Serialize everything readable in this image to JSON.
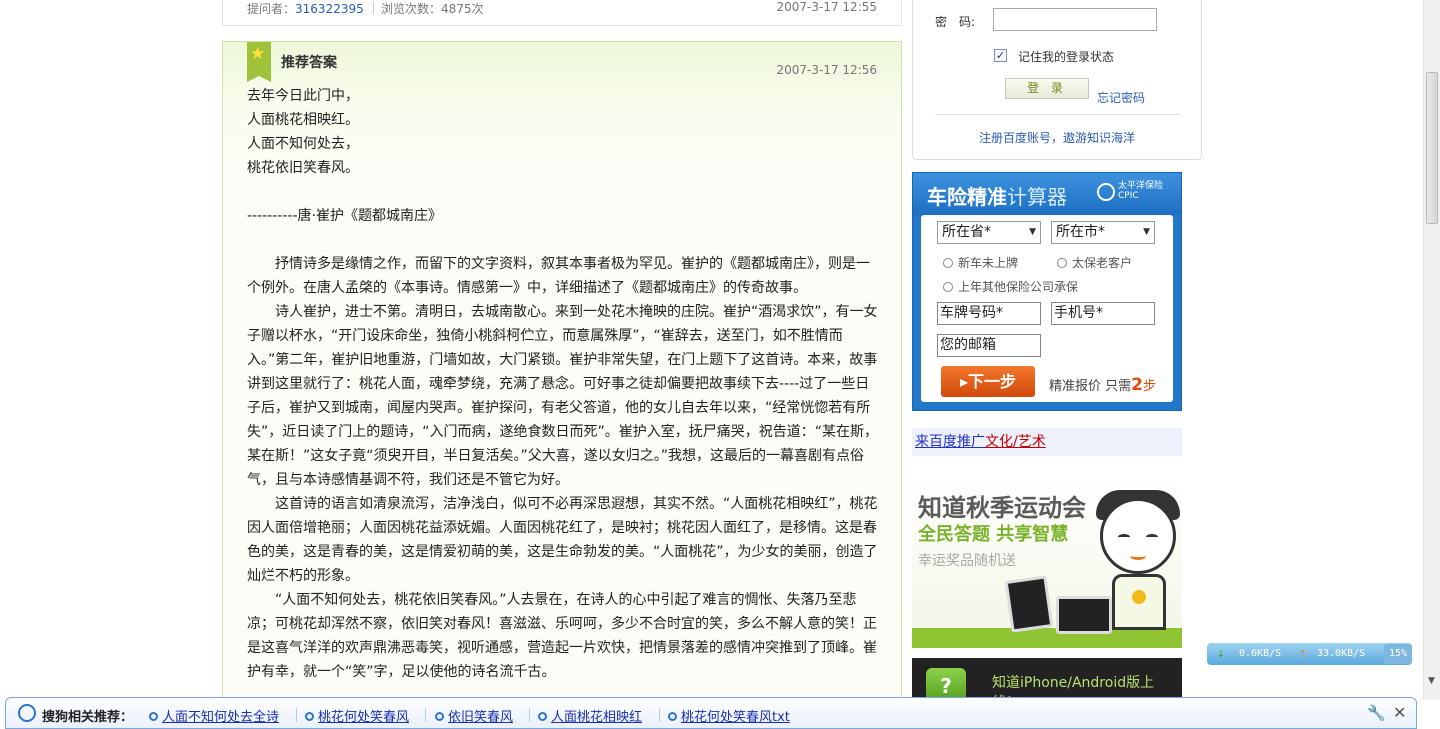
{
  "question_meta": {
    "asker_label": "提问者：",
    "asker_id": "316322395",
    "views_label": "浏览次数：4875次",
    "time": "2007-3-17 12:55"
  },
  "answer": {
    "title": "推荐答案",
    "time": "2007-3-17 12:56",
    "poem": [
      "去年今日此门中，",
      "人面桃花相映红。",
      "人面不知何处去，",
      "桃花依旧笑春风。"
    ],
    "source": "----------唐·崔护《题都城南庄》",
    "paragraphs": [
      "抒情诗多是缘情之作，而留下的文字资料，叙其本事者极为罕见。崔护的《题都城南庄》，则是一个例外。在唐人孟棨的《本事诗。情感第一》中，详细描述了《题都城南庄》的传奇故事。",
      "诗人崔护，进士不第。清明日，去城南散心。来到一处花木掩映的庄院。崔护“酒渴求饮”，有一女子赠以杯水，“开门设床命坐，独倚小桃斜柯伫立，而意属殊厚”，“崔辞去，送至门，如不胜情而入。”第二年，崔护旧地重游，门墙如故，大门紧锁。崔护非常失望，在门上题下了这首诗。本来，故事讲到这里就行了：桃花人面，魂牵梦绕，充满了悬念。可好事之徒却偏要把故事续下去----过了一些日子后，崔护又到城南，闻屋内哭声。崔护探问，有老父答道，他的女儿自去年以来，“经常恍惚若有所失”，近日读了门上的题诗，“入门而病，遂绝食数日而死”。崔护入室，抚尸痛哭，祝告道：“某在斯，某在斯！”这女子竟“须臾开目，半日复活矣。”父大喜，遂以女归之。”我想，这最后的一幕喜剧有点俗气，且与本诗感情基调不符，我们还是不管它为好。",
      "这首诗的语言如清泉流泻，洁净浅白，似可不必再深思遐想，其实不然。“人面桃花相映红”，桃花因人面倍增艳丽；人面因桃花益添妩媚。人面因桃花红了，是映衬；桃花因人面红了，是移情。这是春色的美，这是青春的美，这是情爱初萌的美，这是生命勃发的美。“人面桃花”，为少女的美丽，创造了灿烂不朽的形象。",
      "“人面不知何处去，桃花依旧笑春风。”人去景在，在诗人的心中引起了难言的惆怅、失落乃至悲凉；可桃花却浑然不察，依旧笑对春风！喜滋滋、乐呵呵，多少不合时宜的笑，多么不解人意的笑！正是这喜气洋洋的欢声鼎沸恶毒笑，视听通感，营造起一片欢快，把情景落差的感情冲突推到了顶峰。崔护有幸，就一个“笑”字，足以使他的诗名流千古。"
    ]
  },
  "login": {
    "password_label": "密　码:",
    "remember_label": "记住我的登录状态",
    "remember_checked": true,
    "login_button": "登 录",
    "forgot": "忘记密码",
    "register": "注册百度账号，遨游知识海洋"
  },
  "insurance_ad": {
    "title_bold": "车险精准",
    "title_light": "计算器",
    "brand": "太平洋保险 CPIC",
    "province": "所在省*",
    "city": "所在市*",
    "radio1": "新车未上牌",
    "radio2": "太保老客户",
    "radio3": "上年其他保险公司承保",
    "plate": "车牌号码*",
    "phone": "手机号*",
    "email": "您的邮箱",
    "next": "▸下一步",
    "note_prefix": "精准报价 只需",
    "note_num": "2",
    "note_suffix": "步"
  },
  "baidu_promo": {
    "prefix": "来百度推广",
    "link": "文化/艺术"
  },
  "sports_banner": {
    "line1": "知道秋季运动会",
    "line2": "全民答题  共享智慧",
    "line3": "幸运奖品随机送"
  },
  "app_banner": {
    "icon": "?",
    "text": "知道iPhone/Android版上线！"
  },
  "speed_widget": {
    "down": "0.6KB/S",
    "up": "33.0KB/S",
    "pct": "15%"
  },
  "bottom_bar": {
    "label": "搜狗相关推荐：",
    "items": [
      "人面不知何处去全诗",
      "桃花何处笑春风",
      "依旧笑春风",
      "人面桃花相映红",
      "桃花何处笑春风txt"
    ]
  }
}
